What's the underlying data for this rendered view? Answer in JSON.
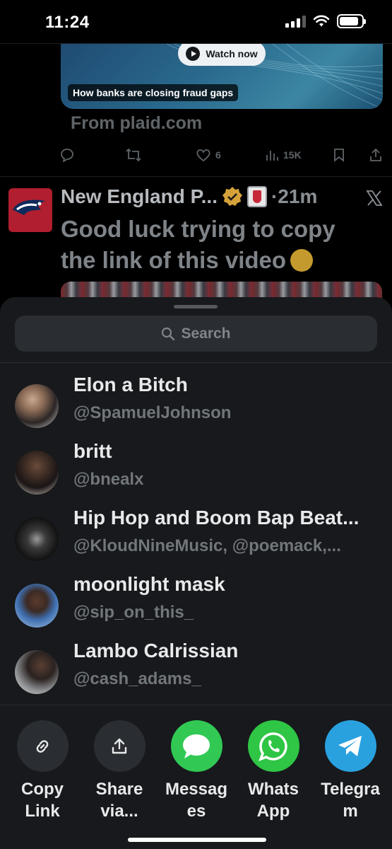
{
  "status_bar": {
    "time": "11:24",
    "battery_level": 0.85
  },
  "promo": {
    "watch_label": "Watch now",
    "caption": "How banks are closing fraud gaps",
    "from": "From plaid.com",
    "likes": "6",
    "views": "15K"
  },
  "tweet": {
    "author": "New England P...",
    "time": "·21m",
    "text": "Good luck trying to copy the link of this video"
  },
  "share_sheet": {
    "search_placeholder": "Search",
    "contacts": [
      {
        "name": "Elon a Bitch",
        "handle": "@SpamuelJohnson"
      },
      {
        "name": "britt",
        "handle": "@bnealx"
      },
      {
        "name": "Hip Hop and Boom Bap Beat...",
        "handle": "@KloudNineMusic, @poemack,..."
      },
      {
        "name": "moonlight mask",
        "handle": "@sip_on_this_"
      },
      {
        "name": "Lambo Calrissian",
        "handle": "@cash_adams_"
      }
    ],
    "apps": [
      {
        "label_line1": "Copy",
        "label_line2": "Link",
        "icon": "link-icon",
        "color": "#2a2d31"
      },
      {
        "label_line1": "Share",
        "label_line2": "via...",
        "icon": "share-upload-icon",
        "color": "#2a2d31"
      },
      {
        "label_line1": "Messag",
        "label_line2": "es",
        "icon": "messages-icon",
        "color": "#31c954"
      },
      {
        "label_line1": "Whats",
        "label_line2": "App",
        "icon": "whatsapp-icon",
        "color": "#2fc545"
      },
      {
        "label_line1": "Telegra",
        "label_line2": "m",
        "icon": "telegram-icon",
        "color": "#2aa1df"
      }
    ]
  }
}
